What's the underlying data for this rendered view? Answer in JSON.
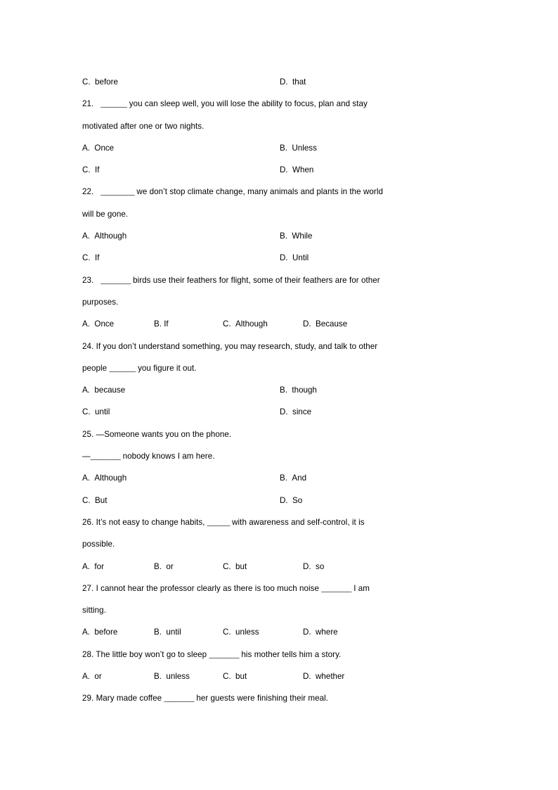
{
  "document": {
    "type": "grammar-worksheet",
    "background_color": "#ffffff",
    "text_color": "#000000"
  },
  "orphan_options": {
    "name": "options-continued-from-previous-question",
    "layout": "2-column",
    "items": [
      {
        "letter": "C.",
        "label": "before"
      },
      {
        "letter": "D.",
        "label": "that"
      }
    ]
  },
  "questions": [
    {
      "number": "21.",
      "lines": [
        {
          "pre": "21.",
          "gap": " ",
          "blank": "_______",
          "post": " you can sleep well, you will lose the ability to focus, plan and stay"
        },
        {
          "pre": "",
          "post": "motivated after one or two nights."
        }
      ],
      "text_line_1_prefix": "21.",
      "text_line_1_blank": "_______",
      "text_line_1_after": " you can sleep well, you will lose the ability to focus, plan and stay",
      "text_line_2": "motivated after one or two nights.",
      "layout": "2-column",
      "options": [
        {
          "letter": "A.",
          "label": "Once"
        },
        {
          "letter": "B.",
          "label": "Unless"
        },
        {
          "letter": "C.",
          "label": "If"
        },
        {
          "letter": "D.",
          "label": "When"
        }
      ]
    },
    {
      "number": "22.",
      "text_line_1_prefix": "22.",
      "text_line_1_blank": "_________",
      "text_line_1_after": " we don’t stop climate change, many animals and plants in the world",
      "text_line_2": "will be gone.",
      "layout": "2-column",
      "options": [
        {
          "letter": "A.",
          "label": "Although"
        },
        {
          "letter": "B.",
          "label": "While"
        },
        {
          "letter": "C.",
          "label": "If"
        },
        {
          "letter": "D.",
          "label": "Until"
        }
      ]
    },
    {
      "number": "23.",
      "text_line_1_prefix": "23.",
      "text_line_1_blank": "________",
      "text_line_1_after": " birds use their feathers for flight, some of their feathers are for other",
      "text_line_2": "purposes.",
      "layout": "4-column",
      "options": [
        {
          "letter": "A.",
          "label": "Once"
        },
        {
          "letter": "B.",
          "label": "If"
        },
        {
          "letter": "C.",
          "label": "Although"
        },
        {
          "letter": "D.",
          "label": "Because"
        }
      ]
    },
    {
      "number": "24.",
      "text_line_1_prefix": "24.",
      "text_line_1_blank": "",
      "text_line_1_after": "  If you don’t understand something, you may research, study, and talk to other",
      "text_line_2_before": "people ",
      "text_line_2_blank": "_______",
      "text_line_2_after": " you figure it out.",
      "layout": "2-column",
      "options": [
        {
          "letter": "A.",
          "label": "because"
        },
        {
          "letter": "B.",
          "label": "though"
        },
        {
          "letter": "C.",
          "label": "until"
        },
        {
          "letter": "D.",
          "label": "since"
        }
      ]
    },
    {
      "number": "25.",
      "text_line_1_prefix": "25.",
      "text_line_1_after": "  —Someone wants you on the phone.",
      "text_line_2_before": "—",
      "text_line_2_blank": "________",
      "text_line_2_after": " nobody knows I am here.",
      "layout": "2-column",
      "options": [
        {
          "letter": "A.",
          "label": "Although"
        },
        {
          "letter": "B.",
          "label": "And"
        },
        {
          "letter": "C.",
          "label": "But"
        },
        {
          "letter": "D.",
          "label": "So"
        }
      ]
    },
    {
      "number": "26.",
      "text_line_1_prefix": "26.",
      "text_line_1_before": "  It’s not easy to change habits, ",
      "text_line_1_blank": "______",
      "text_line_1_after": " with awareness and self-control, it is",
      "text_line_2": "possible.",
      "layout": "4-column",
      "options": [
        {
          "letter": "A.",
          "label": "for"
        },
        {
          "letter": "B.",
          "label": "or"
        },
        {
          "letter": "C.",
          "label": "but"
        },
        {
          "letter": "D.",
          "label": "so"
        }
      ]
    },
    {
      "number": "27.",
      "text_line_1_prefix": "27.",
      "text_line_1_before": "  I cannot hear the professor  clearly as there is too much noise ",
      "text_line_1_blank": "________",
      "text_line_1_after": " I am",
      "text_line_2": "sitting.",
      "layout": "4-column",
      "options": [
        {
          "letter": "A.",
          "label": "before"
        },
        {
          "letter": "B.",
          "label": "until"
        },
        {
          "letter": "C.",
          "label": "unless"
        },
        {
          "letter": "D.",
          "label": "where"
        }
      ]
    },
    {
      "number": "28.",
      "text_line_1_prefix": "28.",
      "text_line_1_before": "  The little boy won’t go to sleep ",
      "text_line_1_blank": "________",
      "text_line_1_after": " his mother tells him a story.",
      "layout": "4-column",
      "options": [
        {
          "letter": "A.",
          "label": "or"
        },
        {
          "letter": "B.",
          "label": "unless"
        },
        {
          "letter": "C.",
          "label": "but"
        },
        {
          "letter": "D.",
          "label": "whether"
        }
      ]
    },
    {
      "number": "29.",
      "text_line_1_prefix": "29.",
      "text_line_1_before": "  Mary made coffee ",
      "text_line_1_blank": "________",
      "text_line_1_after": " her guests were finishing their meal."
    }
  ]
}
